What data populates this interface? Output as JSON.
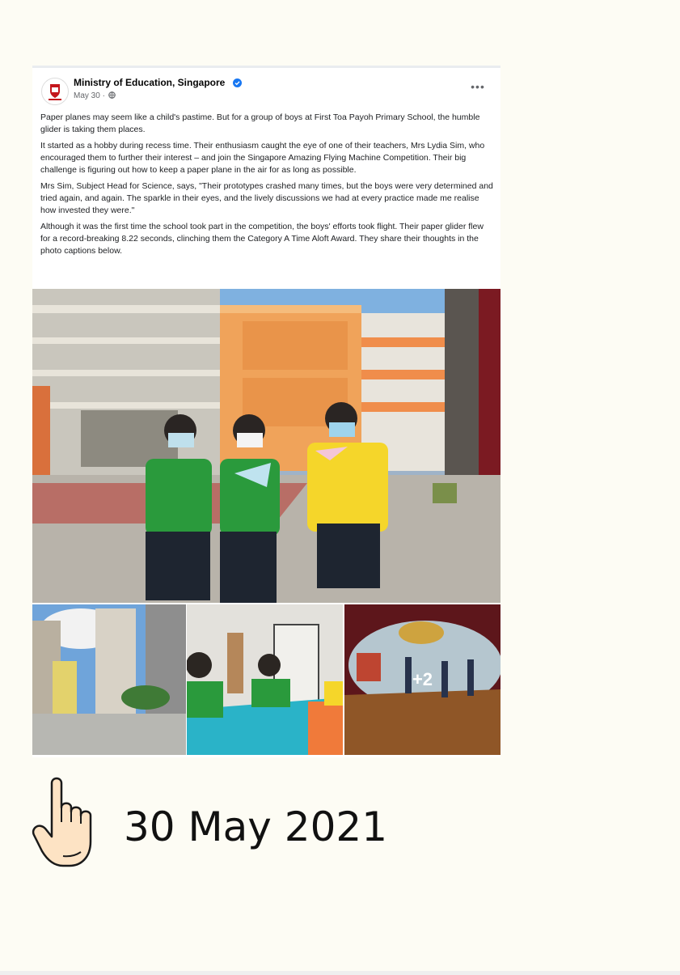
{
  "post": {
    "page_name": "Ministry of Education, Singapore",
    "meta_date": "May 30 ·",
    "more_label": "•••",
    "paragraphs": [
      "Paper planes may seem like a child's pastime. But for a group of boys at First Toa Payoh Primary School, the humble glider is taking them places.",
      "It started as a hobby during recess time. Their enthusiasm caught the eye of one of their teachers, Mrs Lydia Sim, who encouraged them to further their interest – and join the Singapore Amazing Flying Machine Competition. Their big challenge is figuring out how to keep a paper plane in the air for as long as possible.",
      "Mrs Sim, Subject Head for Science, says, \"Their prototypes crashed many times, but the boys were very determined and tried again, and again. The sparkle in their eyes, and the lively discussions we had at every practice made me realise how invested they were.\"",
      "Although it was the first time the school took part in the competition, the boys' efforts took flight. Their paper glider flew for a record-breaking 8.22 seconds, clinching them the Category A Time Aloft Award. They share their thoughts in the photo captions below."
    ],
    "more_photos_label": "+2"
  },
  "caption": {
    "date": "30 May 2021"
  },
  "colors": {
    "page_background": "#fdfcf4",
    "verified_blue": "#1877f2",
    "hand_fill": "#fde3c4"
  },
  "icons": [
    "verified-badge-icon",
    "globe-icon",
    "more-options-icon",
    "pointing-hand-icon"
  ]
}
